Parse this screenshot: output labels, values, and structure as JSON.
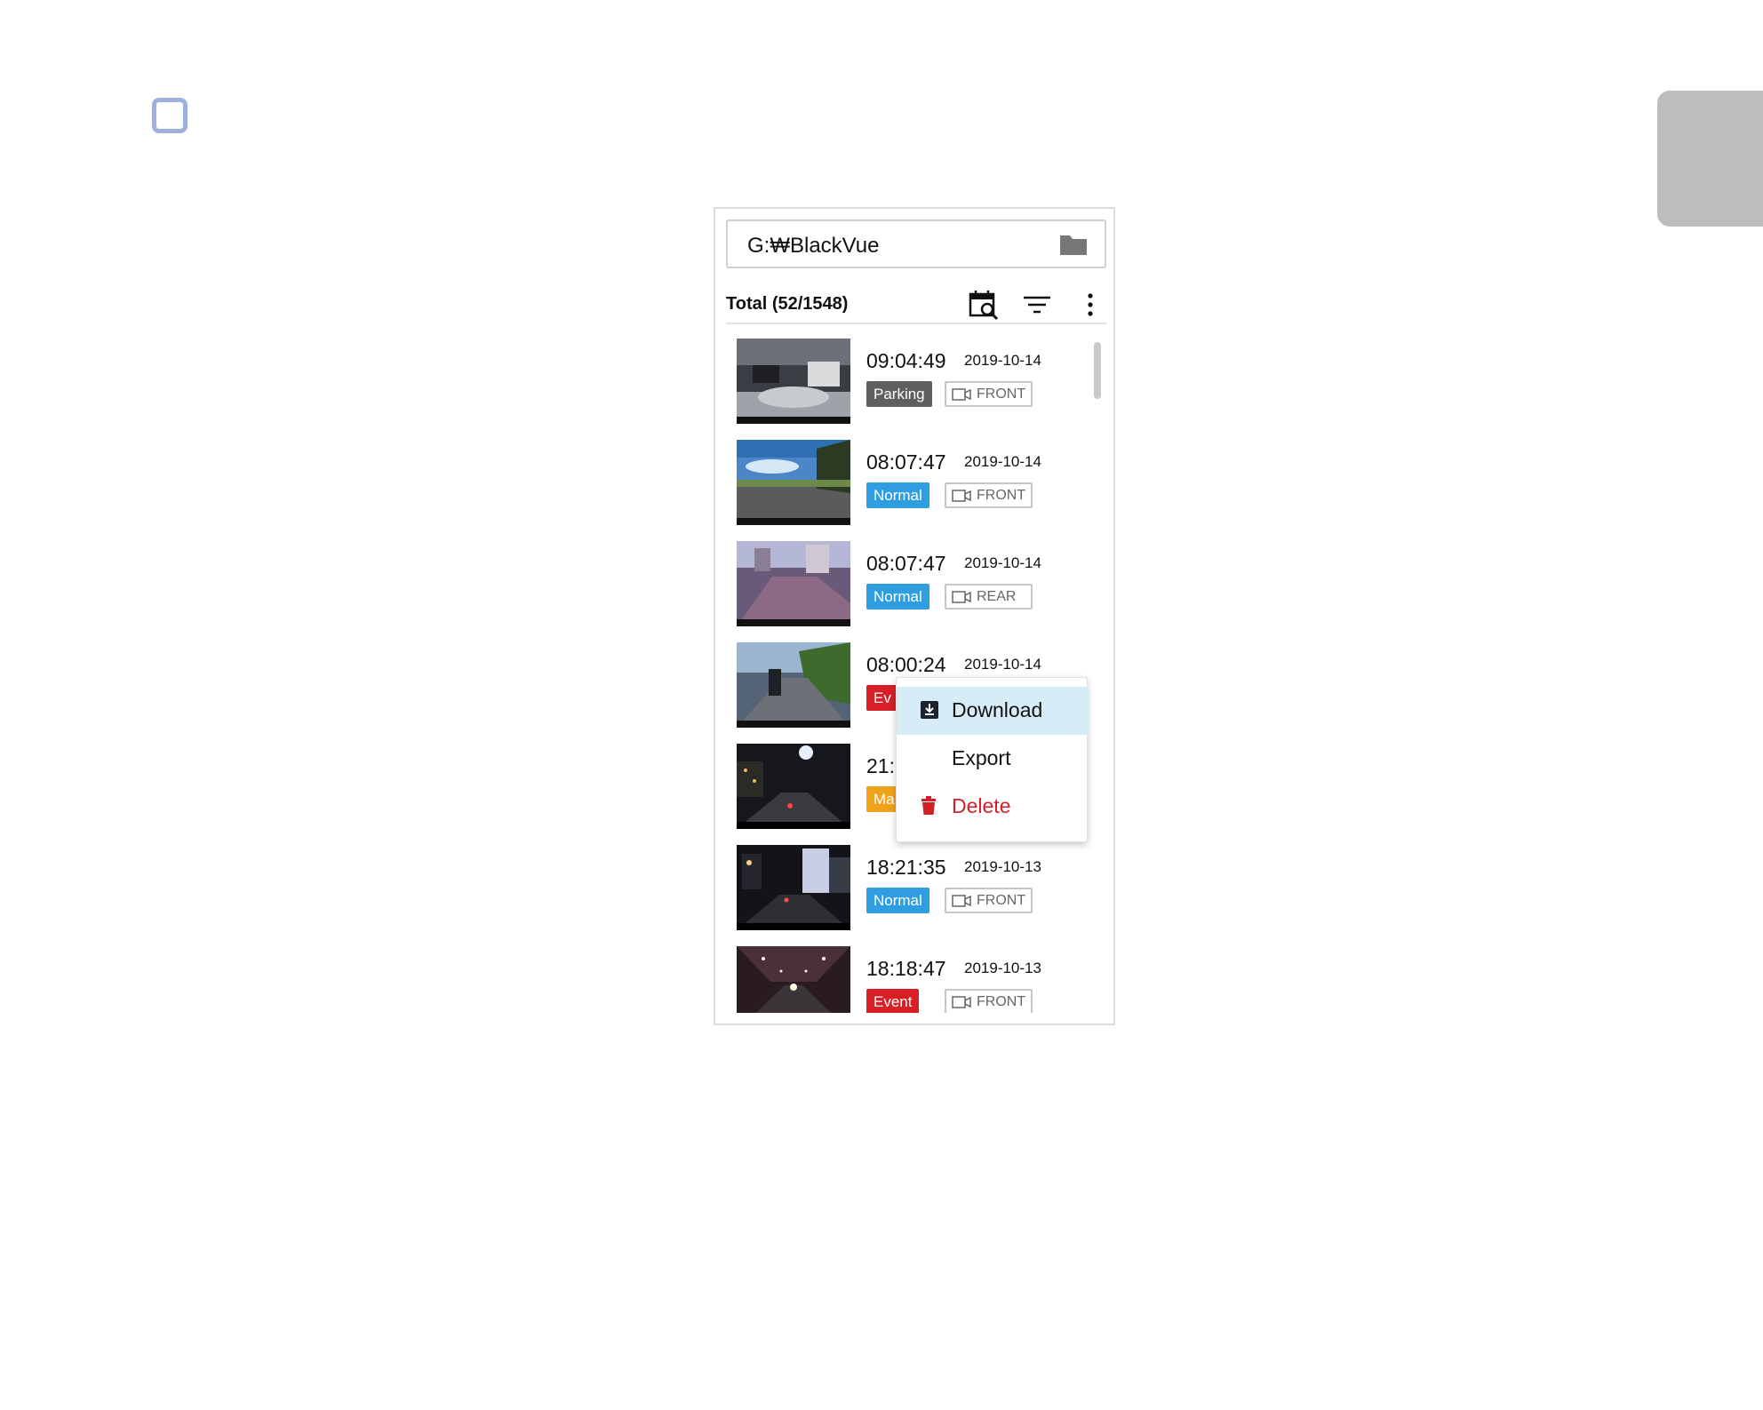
{
  "path_bar": {
    "path": "G:₩BlackVue"
  },
  "toolbar": {
    "total_label": "Total (52/1548)"
  },
  "colors": {
    "parking": "#5f5f5f",
    "normal": "#2e9ee0",
    "event": "#d91f26",
    "manual": "#f0a21a",
    "menu_highlight": "#d6edf8",
    "delete": "#d0202a"
  },
  "recordings": [
    {
      "time": "09:04:49",
      "date": "2019-10-14",
      "type": "Parking",
      "camera": "FRONT"
    },
    {
      "time": "08:07:47",
      "date": "2019-10-14",
      "type": "Normal",
      "camera": "FRONT"
    },
    {
      "time": "08:07:47",
      "date": "2019-10-14",
      "type": "Normal",
      "camera": "REAR"
    },
    {
      "time": "08:00:24",
      "date": "2019-10-14",
      "type": "Ev",
      "camera": ""
    },
    {
      "time": "21:",
      "date": "",
      "type": "Ma",
      "camera": ""
    },
    {
      "time": "18:21:35",
      "date": "2019-10-13",
      "type": "Normal",
      "camera": "FRONT"
    },
    {
      "time": "18:18:47",
      "date": "2019-10-13",
      "type": "Event",
      "camera": "FRONT"
    }
  ],
  "context_menu": {
    "download": {
      "label": "Download",
      "icon": "download-icon"
    },
    "export": {
      "label": "Export"
    },
    "delete": {
      "label": "Delete",
      "icon": "trash-icon"
    }
  }
}
